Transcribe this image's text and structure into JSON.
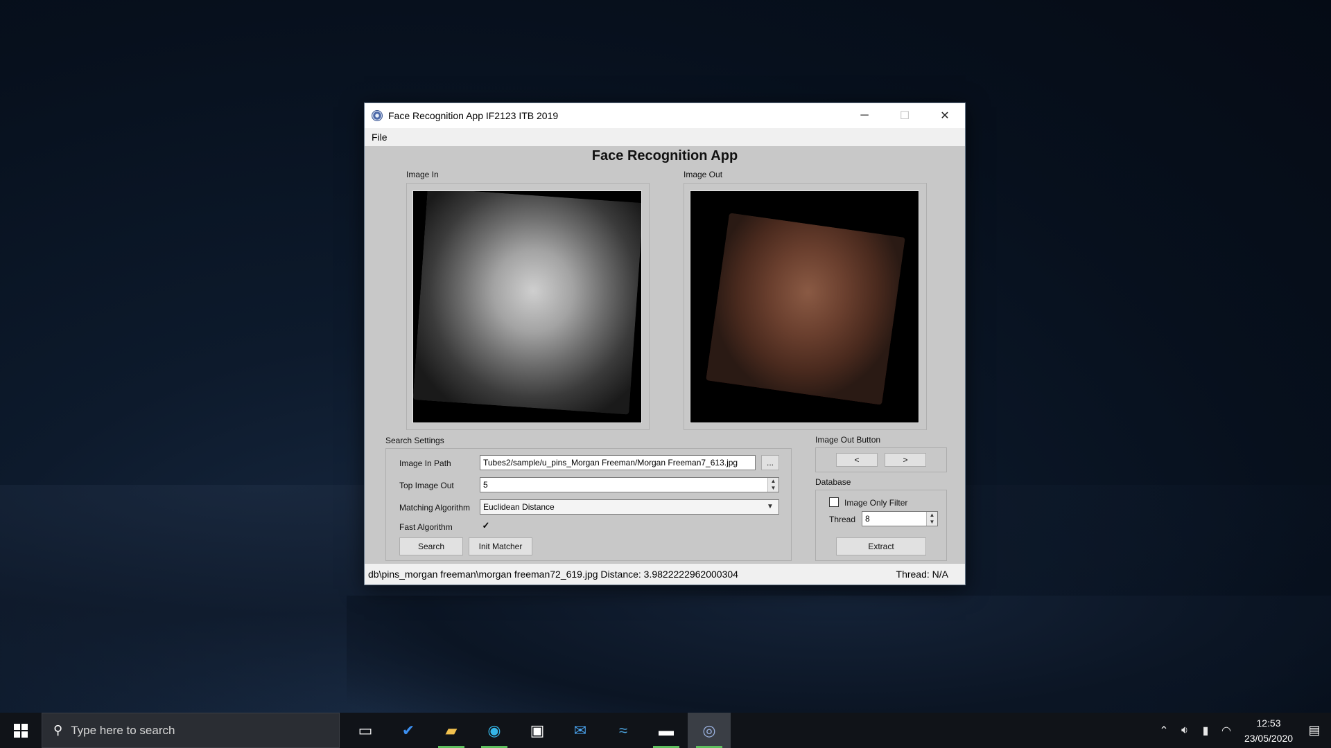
{
  "window": {
    "title": "Face Recognition App IF2123 ITB 2019",
    "controls": {
      "minimize": "─",
      "maximize": "☐",
      "close": "✕"
    }
  },
  "menu": {
    "file": "File"
  },
  "app": {
    "heading": "Face Recognition App",
    "image_in_label": "Image In",
    "image_out_label": "Image Out"
  },
  "search_settings": {
    "title": "Search Settings",
    "image_in_path_label": "Image In Path",
    "image_in_path_value": "Tubes2/sample/u_pins_Morgan Freeman/Morgan Freeman7_613.jpg",
    "browse_label": "...",
    "top_image_out_label": "Top Image Out",
    "top_image_out_value": "5",
    "matching_algorithm_label": "Matching Algorithm",
    "matching_algorithm_value": "Euclidean Distance",
    "fast_algorithm_label": "Fast Algorithm",
    "fast_algorithm_checked": "✓",
    "search_button": "Search",
    "init_matcher_button": "Init Matcher"
  },
  "image_out_buttons": {
    "title": "Image Out Button",
    "prev": "<",
    "next": ">"
  },
  "database": {
    "title": "Database",
    "image_only_filter_label": "Image Only Filter",
    "thread_label": "Thread",
    "thread_value": "8",
    "extract_button": "Extract"
  },
  "statusbar": {
    "left": "db\\pins_morgan freeman\\morgan freeman72_619.jpg Distance: 3.9822222962000304",
    "right": "Thread: N/A"
  },
  "taskbar": {
    "search_placeholder": "Type here to search",
    "time": "12:53",
    "date": "23/05/2020",
    "icons": [
      "task-view-icon",
      "todo-icon",
      "file-explorer-icon",
      "edge-icon",
      "store-icon",
      "mail-icon",
      "dolphin-icon",
      "terminal-icon",
      "face-app-icon"
    ]
  }
}
